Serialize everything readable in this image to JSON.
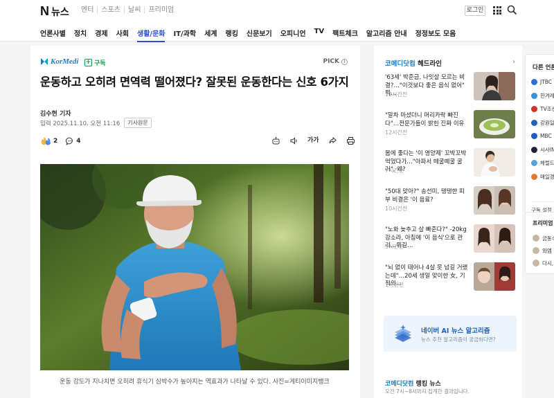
{
  "header": {
    "logo_n": "N",
    "logo_news": "뉴스",
    "service_nav": [
      "엔터",
      "스포츠",
      "날씨",
      "프리미엄"
    ],
    "login_label": "로그인"
  },
  "categories": [
    {
      "label": "언론사별",
      "active": false
    },
    {
      "label": "정치",
      "active": false
    },
    {
      "label": "경제",
      "active": false
    },
    {
      "label": "사회",
      "active": false
    },
    {
      "label": "생활/문화",
      "active": true
    },
    {
      "label": "IT/과학",
      "active": false
    },
    {
      "label": "세계",
      "active": false
    },
    {
      "label": "랭킹",
      "active": false
    },
    {
      "label": "신문보기",
      "active": false
    },
    {
      "label": "오피니언",
      "active": false
    },
    {
      "label": "TV",
      "active": false
    },
    {
      "label": "팩트체크",
      "active": false
    },
    {
      "label": "알고리즘 안내",
      "active": false
    },
    {
      "label": "정정보도 모음",
      "active": false
    }
  ],
  "article": {
    "press_name": "KorMedi",
    "subscribe_label": "구독",
    "pick_label": "PICK",
    "headline": "운동하고 오히려 면역력 떨어졌다? 잘못된 운동한다는 신호 6가지",
    "byline": "김수현 기자",
    "date_prefix": "입력",
    "date": "2025.11.10. 오전 11:16",
    "original_label": "기사원문",
    "reaction_count": "2",
    "comment_count": "4",
    "font_tool_label": "가가",
    "caption": "운동 강도가 지나치면 오히려 휴식기 심박수가 높아지는 역효과가 나타날 수 있다. 사진=게티이미지뱅크"
  },
  "sidebar": {
    "headline_brand": "코메디닷컴",
    "headline_title": "헤드라인",
    "items": [
      {
        "title": "'63세' 박준금, 나잇살 모르는 비결?…\"이것보다 좋은 음식 없어\" 뭐…",
        "time": "12시간전"
      },
      {
        "title": "\"말차 마셨더니 머리카락 빠진다\"…전문가들이 밝힌 진짜 이유",
        "time": "12시간전"
      },
      {
        "title": "몸에 좋다는 '이 영양제' 꼬박꼬박 먹었다가…\"아파서 떼굴떼굴 굴러\", 왜?",
        "time": "7시간전"
      },
      {
        "title": "\"50대 맞아?\" 송선미, 탱탱한 피부 비결은 '이 음료?",
        "time": "10시간전"
      },
      {
        "title": "\"노화 늦추고 살 빠준다?\" -20kg 강소라, 아침에 '이 음식'으로 관리…뭐길…",
        "time": "3시간전"
      },
      {
        "title": "\"뇌 없이 태어나 4살 못 넘길 거랬는데\"…20세 생일 맞이한 女, 기적의…",
        "time": "1시간전"
      }
    ],
    "ai_title": "네이버 AI 뉴스 알고리즘",
    "ai_sub": "뉴스 추천 알고리즘이 궁금하다면?",
    "ranking_brand": "코메디닷컴",
    "ranking_title": "랭킹 뉴스",
    "ranking_sub": "오전 7시~8시까지 집계한 결과입니다."
  },
  "far_right": {
    "title": "다른 언론사",
    "press": [
      {
        "name": "JTBC",
        "color": "#2d6dd8"
      },
      {
        "name": "한겨레",
        "color": "#3c8fd8"
      },
      {
        "name": "TV조선",
        "color": "#d62f2f"
      },
      {
        "name": "강원일보",
        "color": "#1f62b8"
      },
      {
        "name": "MBC",
        "color": "#2257c7"
      },
      {
        "name": "시사IN",
        "color": "#222233"
      },
      {
        "name": "헤럴드경제",
        "color": "#5aa0d8"
      },
      {
        "name": "매일경제",
        "color": "#e8792c"
      }
    ],
    "subscribe_label": "구독 설정",
    "premium_title": "프리미엄 추천",
    "premium_items": [
      "금동수",
      "와엠",
      "다시, 사"
    ]
  }
}
